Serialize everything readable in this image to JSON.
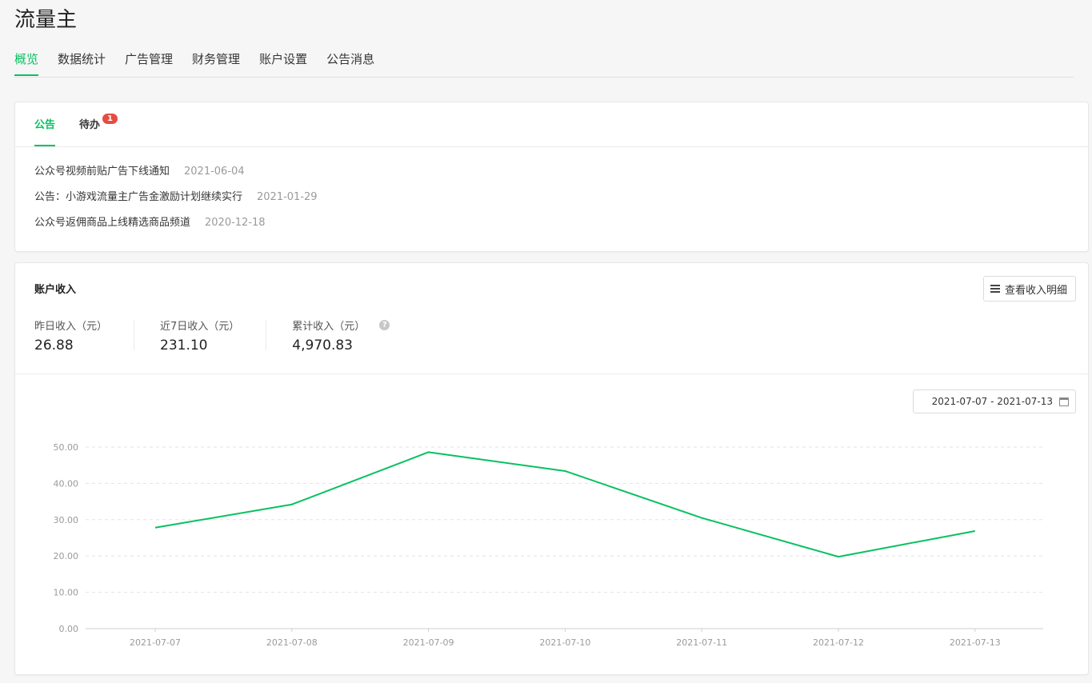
{
  "app": {
    "title": "流量主"
  },
  "nav": {
    "items": [
      "概览",
      "数据统计",
      "广告管理",
      "财务管理",
      "账户设置",
      "公告消息"
    ]
  },
  "notice_panel": {
    "tabs": [
      {
        "label": "公告"
      },
      {
        "label": "待办",
        "badge": "1"
      }
    ],
    "items": [
      {
        "title": "公众号视频前贴广告下线通知",
        "date": "2021-06-04"
      },
      {
        "title": "公告：小游戏流量主广告金激励计划继续实行",
        "date": "2021-01-29"
      },
      {
        "title": "公众号返佣商品上线精选商品频道",
        "date": "2020-12-18"
      }
    ]
  },
  "income": {
    "title": "账户收入",
    "detail_button": "查看收入明细",
    "stats": [
      {
        "label": "昨日收入（元）",
        "value": "26.88"
      },
      {
        "label": "近7日收入（元）",
        "value": "231.10"
      },
      {
        "label": "累计收入（元）",
        "value": "4,970.83"
      }
    ],
    "help_icon": "question-circle-icon",
    "date_range": "2021-07-07 - 2021-07-13",
    "date_range_icon": "calendar-icon"
  },
  "colors": {
    "accent": "#07c160",
    "badge": "#e54d42"
  },
  "chart_data": {
    "type": "line",
    "title": "",
    "xlabel": "",
    "ylabel": "",
    "x": [
      "2021-07-07",
      "2021-07-08",
      "2021-07-09",
      "2021-07-10",
      "2021-07-11",
      "2021-07-12",
      "2021-07-13"
    ],
    "series": [
      {
        "values": [
          27.8,
          34.2,
          48.6,
          43.4,
          30.5,
          19.8,
          26.88
        ],
        "color": "#07c160"
      }
    ],
    "y_ticks": [
      "0.00",
      "10.00",
      "20.00",
      "30.00",
      "40.00",
      "50.00"
    ],
    "ylim": [
      0,
      50
    ],
    "grid": true,
    "legend": "none"
  }
}
